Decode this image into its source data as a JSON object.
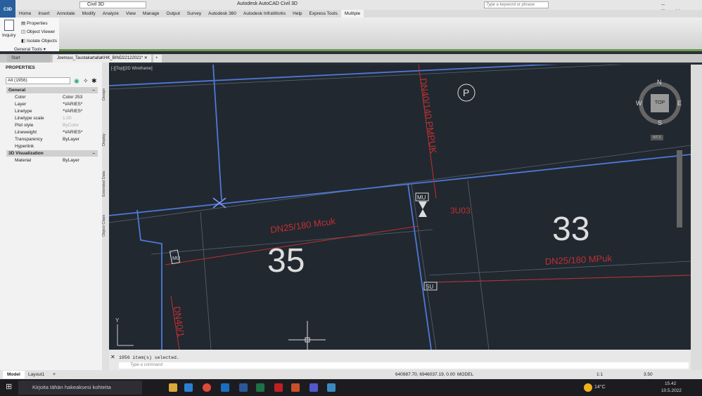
{
  "app": {
    "logo": "C3D",
    "title": "Autodesk AutoCAD Civil 3D",
    "workspace": "Civil 3D",
    "search_placeholder": "Type a keyword or phrase"
  },
  "menu": [
    "Home",
    "Insert",
    "Annotate",
    "Modify",
    "Analyze",
    "View",
    "Manage",
    "Output",
    "Survey",
    "Autodesk 360",
    "Autodesk InfraWorks",
    "Help",
    "Express Tools",
    "Multiple"
  ],
  "ribbon": {
    "inquiry": "Inquiry",
    "properties": "Properties",
    "object_viewer": "Object Viewer",
    "isolate_objects": "Isolate Objects",
    "panel_title": "General Tools ▾"
  },
  "file_tabs": {
    "start": "Start",
    "active": "Joensuu_TaustakartallaKHK_BIND22122021*"
  },
  "properties": {
    "title": "PROPERTIES",
    "selection": "All (1956)",
    "sections": [
      {
        "name": "General",
        "rows": [
          [
            "Color",
            "Color 253"
          ],
          [
            "Layer",
            "*VARIES*"
          ],
          [
            "Linetype",
            "*VARIES*"
          ],
          [
            "Linetype scale",
            "1.00"
          ],
          [
            "Plot style",
            "ByColor"
          ],
          [
            "Lineweight",
            "*VARIES*"
          ],
          [
            "Transparency",
            "ByLayer"
          ],
          [
            "Hyperlink",
            ""
          ]
        ]
      },
      {
        "name": "3D Visualization",
        "rows": [
          [
            "Material",
            "ByLayer"
          ]
        ]
      }
    ]
  },
  "side_tabs": [
    "Design",
    "Display",
    "Extended Data",
    "Object Class"
  ],
  "viewport": {
    "label": "[-][Top][2D Wireframe]",
    "compass": {
      "n": "N",
      "s": "S",
      "e": "E",
      "w": "W",
      "top": "TOP",
      "wcs": "WCS"
    },
    "texts": [
      "DN25/180 Mcuk",
      "DN25/180 MPuk",
      "DN40/140 PMPUK",
      "DN40/1",
      "35",
      "33",
      "P",
      "MU",
      "MU",
      "SU",
      "MU",
      "3U03"
    ],
    "axis_y": "Y"
  },
  "command": {
    "history": "1956 item(s) selected.",
    "placeholder": "Type a command"
  },
  "layout_tabs": [
    "Model",
    "Layout1",
    "+"
  ],
  "status": {
    "coords": "640987.70, 6946037.19, 0.00",
    "mode": "MODEL",
    "scale": "1:1",
    "value": "3.50"
  },
  "taskbar": {
    "search": "Kirjoita tähän hakeaksesi kohteita",
    "weather": "14°C",
    "time": "15.42",
    "date": "10.5.2022"
  }
}
